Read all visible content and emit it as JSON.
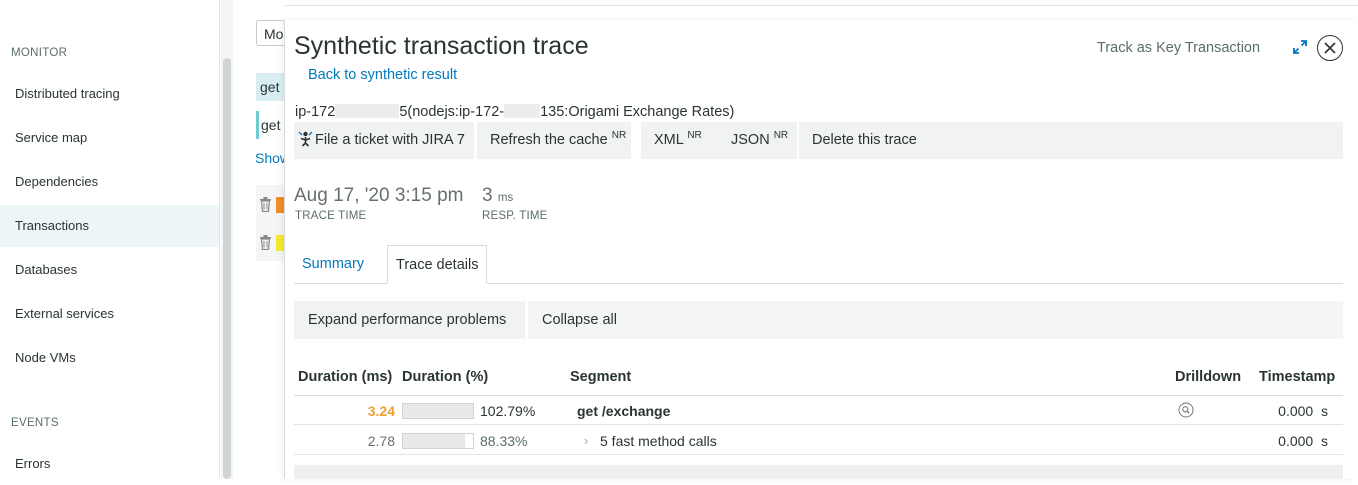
{
  "sidebar": {
    "monitor_label": "MONITOR",
    "items": [
      {
        "label": "Distributed tracing"
      },
      {
        "label": "Service map"
      },
      {
        "label": "Dependencies"
      },
      {
        "label": "Transactions"
      },
      {
        "label": "Databases"
      },
      {
        "label": "External services"
      },
      {
        "label": "Node VMs"
      }
    ],
    "events_label": "EVENTS",
    "events_items": [
      {
        "label": "Errors"
      }
    ]
  },
  "background": {
    "select_value": "Mo",
    "row1": "get",
    "row2": "get",
    "show_link": "Show",
    "tag1_color": "#f28c28",
    "tag2_color": "#f5e92d"
  },
  "modal": {
    "title": "Synthetic transaction trace",
    "back_link": "Back to synthetic result",
    "track_link": "Track as Key Transaction",
    "host": {
      "prefix": "ip-172",
      "mid": "5(nodejs:ip-172-",
      "suffix": "135:Origami Exchange Rates)"
    },
    "toolbar": {
      "jira": "File a ticket with JIRA 7",
      "refresh": "Refresh the cache",
      "refresh_sup": "NR",
      "xml": "XML",
      "xml_sup": "NR",
      "json": "JSON",
      "json_sup": "NR",
      "delete": "Delete this trace"
    },
    "trace_time": {
      "value": "Aug 17, '20 3:15 pm",
      "label": "TRACE TIME"
    },
    "resp_time": {
      "value": "3",
      "unit": "ms",
      "label": "RESP. TIME"
    },
    "tabs": {
      "summary": "Summary",
      "details": "Trace details"
    },
    "actions": {
      "expand": "Expand performance problems",
      "collapse": "Collapse all"
    },
    "table": {
      "headers": {
        "duration_ms": "Duration (ms)",
        "duration_pct": "Duration (%)",
        "segment": "Segment",
        "drilldown": "Drilldown",
        "timestamp": "Timestamp"
      },
      "rows": [
        {
          "duration_ms": "3.24",
          "duration_pct": "102.79%",
          "fill_pct": 100,
          "segment": "get /exchange",
          "timestamp": "0.000",
          "ts_unit": "s"
        },
        {
          "duration_ms": "2.78",
          "duration_pct": "88.33%",
          "fill_pct": 88.33,
          "segment": "5 fast method calls",
          "timestamp": "0.000",
          "ts_unit": "s"
        }
      ]
    }
  },
  "colors": {
    "link": "#0079bf",
    "highlight_duration": "#f0a030"
  }
}
